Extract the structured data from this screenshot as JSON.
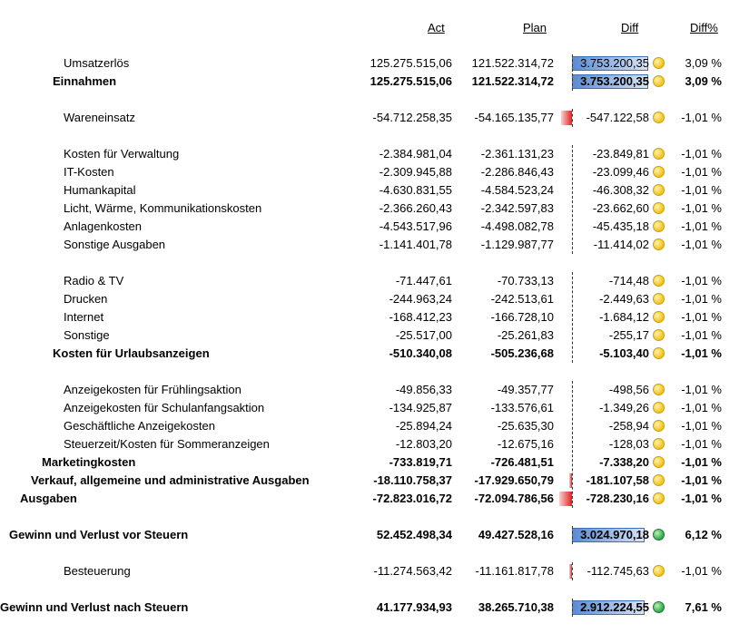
{
  "headers": {
    "act": "Act",
    "plan": "Plan",
    "diff": "Diff",
    "diff_pct": "Diff%"
  },
  "colors": {
    "positive_bar": "#5b8bd0",
    "negative_bar": "#e81f1f",
    "status_neutral": "#f2c21b",
    "status_good": "#2ea84a"
  },
  "rows": [
    {
      "label": "Umsatzerlös",
      "act": "125.275.515,06",
      "plan": "121.522.314,72",
      "diff": "3.753.200,35",
      "pct": "3,09 %",
      "status": "yellow",
      "bold": false
    },
    {
      "label": "Einnahmen",
      "act": "125.275.515,06",
      "plan": "121.522.314,72",
      "diff": "3.753.200,35",
      "pct": "3,09 %",
      "status": "yellow",
      "bold": true
    },
    {
      "label": "Wareneinsatz",
      "act": "-54.712.258,35",
      "plan": "-54.165.135,77",
      "diff": "-547.122,58",
      "pct": "-1,01 %",
      "status": "yellow",
      "bold": false
    },
    {
      "label": "Kosten für Verwaltung",
      "act": "-2.384.981,04",
      "plan": "-2.361.131,23",
      "diff": "-23.849,81",
      "pct": "-1,01 %",
      "status": "yellow",
      "bold": false
    },
    {
      "label": "IT-Kosten",
      "act": "-2.309.945,88",
      "plan": "-2.286.846,43",
      "diff": "-23.099,46",
      "pct": "-1,01 %",
      "status": "yellow",
      "bold": false
    },
    {
      "label": "Humankapital",
      "act": "-4.630.831,55",
      "plan": "-4.584.523,24",
      "diff": "-46.308,32",
      "pct": "-1,01 %",
      "status": "yellow",
      "bold": false
    },
    {
      "label": "Licht, Wärme, Kommunikationskosten",
      "act": "-2.366.260,43",
      "plan": "-2.342.597,83",
      "diff": "-23.662,60",
      "pct": "-1,01 %",
      "status": "yellow",
      "bold": false
    },
    {
      "label": "Anlagenkosten",
      "act": "-4.543.517,96",
      "plan": "-4.498.082,78",
      "diff": "-45.435,18",
      "pct": "-1,01 %",
      "status": "yellow",
      "bold": false
    },
    {
      "label": "Sonstige Ausgaben",
      "act": "-1.141.401,78",
      "plan": "-1.129.987,77",
      "diff": "-11.414,02",
      "pct": "-1,01 %",
      "status": "yellow",
      "bold": false
    },
    {
      "label": "Radio & TV",
      "act": "-71.447,61",
      "plan": "-70.733,13",
      "diff": "-714,48",
      "pct": "-1,01 %",
      "status": "yellow",
      "bold": false
    },
    {
      "label": "Drucken",
      "act": "-244.963,24",
      "plan": "-242.513,61",
      "diff": "-2.449,63",
      "pct": "-1,01 %",
      "status": "yellow",
      "bold": false
    },
    {
      "label": "Internet",
      "act": "-168.412,23",
      "plan": "-166.728,10",
      "diff": "-1.684,12",
      "pct": "-1,01 %",
      "status": "yellow",
      "bold": false
    },
    {
      "label": "Sonstige",
      "act": "-25.517,00",
      "plan": "-25.261,83",
      "diff": "-255,17",
      "pct": "-1,01 %",
      "status": "yellow",
      "bold": false
    },
    {
      "label": "Kosten für Urlaubsanzeigen",
      "act": "-510.340,08",
      "plan": "-505.236,68",
      "diff": "-5.103,40",
      "pct": "-1,01 %",
      "status": "yellow",
      "bold": true
    },
    {
      "label": "Anzeigekosten für Frühlingsaktion",
      "act": "-49.856,33",
      "plan": "-49.357,77",
      "diff": "-498,56",
      "pct": "-1,01 %",
      "status": "yellow",
      "bold": false
    },
    {
      "label": "Anzeigekosten für Schulanfangsaktion",
      "act": "-134.925,87",
      "plan": "-133.576,61",
      "diff": "-1.349,26",
      "pct": "-1,01 %",
      "status": "yellow",
      "bold": false
    },
    {
      "label": "Geschäftliche Anzeigekosten",
      "act": "-25.894,24",
      "plan": "-25.635,30",
      "diff": "-258,94",
      "pct": "-1,01 %",
      "status": "yellow",
      "bold": false
    },
    {
      "label": "Steuerzeit/Kosten für Sommeranzeigen",
      "act": "-12.803,20",
      "plan": "-12.675,16",
      "diff": "-128,03",
      "pct": "-1,01 %",
      "status": "yellow",
      "bold": false
    },
    {
      "label": "Marketingkosten",
      "act": "-733.819,71",
      "plan": "-726.481,51",
      "diff": "-7.338,20",
      "pct": "-1,01 %",
      "status": "yellow",
      "bold": true
    },
    {
      "label": "Verkauf, allgemeine und administrative Ausgaben",
      "act": "-18.110.758,37",
      "plan": "-17.929.650,79",
      "diff": "-181.107,58",
      "pct": "-1,01 %",
      "status": "yellow",
      "bold": true
    },
    {
      "label": "Ausgaben",
      "act": "-72.823.016,72",
      "plan": "-72.094.786,56",
      "diff": "-728.230,16",
      "pct": "-1,01 %",
      "status": "yellow",
      "bold": true
    },
    {
      "label": "Gewinn und Verlust vor Steuern",
      "act": "52.452.498,34",
      "plan": "49.427.528,16",
      "diff": "3.024.970,18",
      "pct": "6,12 %",
      "status": "green",
      "bold": true
    },
    {
      "label": "Besteuerung",
      "act": "-11.274.563,42",
      "plan": "-11.161.817,78",
      "diff": "-112.745,63",
      "pct": "-1,01 %",
      "status": "yellow",
      "bold": false
    },
    {
      "label": "Gewinn und Verlust nach Steuern",
      "act": "41.177.934,93",
      "plan": "38.265.710,38",
      "diff": "2.912.224,55",
      "pct": "7,61 %",
      "status": "green",
      "bold": true
    }
  ]
}
